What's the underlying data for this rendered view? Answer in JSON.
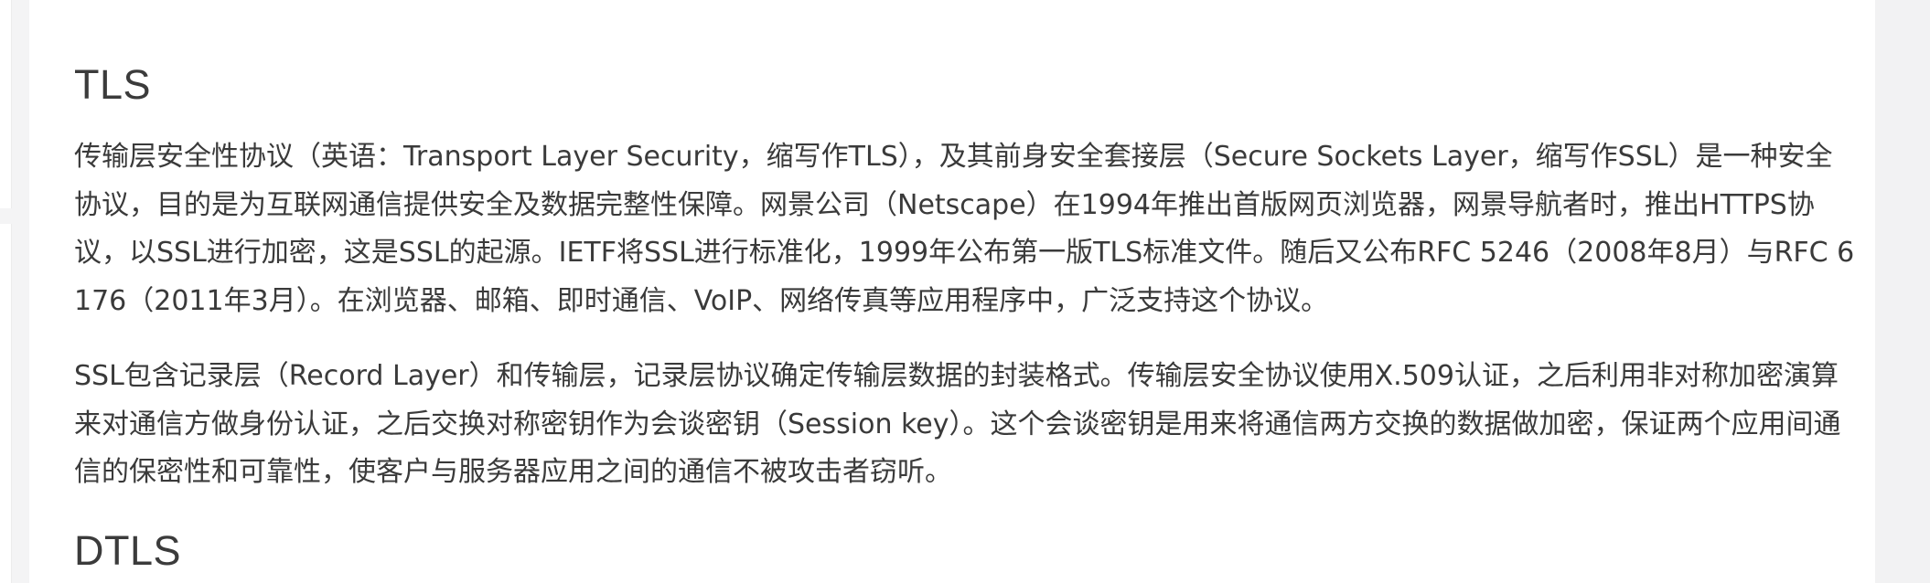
{
  "article": {
    "sections": [
      {
        "heading": "TLS",
        "paragraphs": [
          "传输层安全性协议（英语：Transport Layer Security，缩写作TLS），及其前身安全套接层（Secure Sockets Layer，缩写作SSL）是一种安全协议，目的是为互联网通信提供安全及数据完整性保障。网景公司（Netscape）在1994年推出首版网页浏览器，网景导航者时，推出HTTPS协议，以SSL进行加密，这是SSL的起源。IETF将SSL进行标准化，1999年公布第一版TLS标准文件。随后又公布RFC 5246（2008年8月）与RFC 6176（2011年3月）。在浏览器、邮箱、即时通信、VoIP、网络传真等应用程序中，广泛支持这个协议。",
          "SSL包含记录层（Record Layer）和传输层，记录层协议确定传输层数据的封装格式。传输层安全协议使用X.509认证，之后利用非对称加密演算来对通信方做身份认证，之后交换对称密钥作为会谈密钥（Session key）。这个会谈密钥是用来将通信两方交换的数据做加密，保证两个应用间通信的保密性和可靠性，使客户与服务器应用之间的通信不被攻击者窃听。"
        ]
      },
      {
        "heading": "DTLS"
      }
    ]
  }
}
